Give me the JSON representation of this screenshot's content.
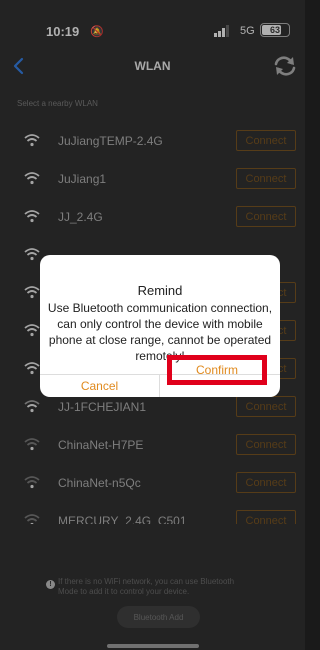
{
  "status_bar": {
    "time": "10:19",
    "network_type": "5G",
    "battery_level": "63"
  },
  "nav": {
    "title": "WLAN"
  },
  "section_label": "Select a nearby WLAN",
  "wlan_list": [
    {
      "name": "JuJiangTEMP-2.4G",
      "connect_label": "Connect"
    },
    {
      "name": "JuJiang1",
      "connect_label": "Connect"
    },
    {
      "name": "JJ_2.4G",
      "connect_label": "Connect"
    },
    {
      "name": "",
      "connect_label": ""
    },
    {
      "name": "",
      "connect_label": "Connect"
    },
    {
      "name": "",
      "connect_label": "Connect"
    },
    {
      "name": "",
      "connect_label": "Connect"
    },
    {
      "name": "JJ-1FCHEJIAN1",
      "connect_label": "Connect"
    },
    {
      "name": "ChinaNet-H7PE",
      "connect_label": "Connect"
    },
    {
      "name": "ChinaNet-n5Qc",
      "connect_label": "Connect"
    },
    {
      "name": "MERCURY_2.4G_C501",
      "connect_label": "Connect"
    }
  ],
  "footer": {
    "note": "If there is no WiFi network, you can use Bluetooth Mode to add it to control your device.",
    "bluetooth_add_label": "Bluetooth Add"
  },
  "dialog": {
    "title": "Remind",
    "message": "Use Bluetooth communication connection, can only control the device with mobile phone at close range, cannot be operated remotely!",
    "cancel_label": "Cancel",
    "confirm_label": "Confirm"
  },
  "colors": {
    "accent": "#e08a1e",
    "highlight_box": "#e0001b",
    "back_arrow": "#2f6fc7"
  }
}
